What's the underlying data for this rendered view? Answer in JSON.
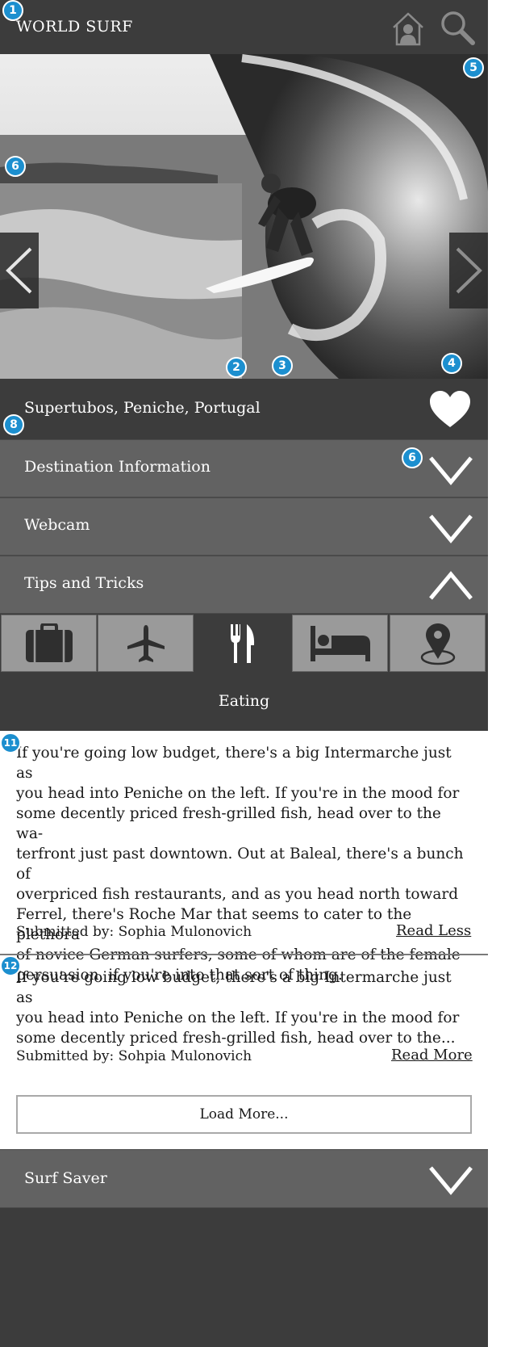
{
  "header": {
    "brand": "WORLD SURF",
    "home_icon": "home-person-icon",
    "search_icon": "search-icon"
  },
  "hero": {
    "image_desc_icon": "surfer-photo",
    "prev_icon": "chevron-left-icon",
    "next_icon": "chevron-right-icon"
  },
  "markers": [
    "1",
    "2",
    "3",
    "4",
    "5",
    "6",
    "6",
    "8",
    "11",
    "12"
  ],
  "location": {
    "title": "Supertubos, Peniche, Portugal",
    "favorite_icon": "heart-icon"
  },
  "accordion": [
    {
      "label": "Destination Information",
      "expanded": false
    },
    {
      "label": "Webcam",
      "expanded": false
    },
    {
      "label": "Tips and Tricks",
      "expanded": true
    },
    {
      "label": "Surf Saver",
      "expanded": false
    }
  ],
  "tabs": [
    {
      "icon": "suitcase-icon",
      "active": false
    },
    {
      "icon": "airplane-icon",
      "active": false
    },
    {
      "icon": "fork-knife-icon",
      "active": true
    },
    {
      "icon": "bed-icon",
      "active": false
    },
    {
      "icon": "location-pin-icon",
      "active": false
    }
  ],
  "active_tab_label": "Eating",
  "tips": [
    {
      "lines": [
        "If you're going low budget, there's a big Intermarche just as",
        "you head into Peniche on the left. If you're in the mood for",
        "some decently priced fresh-grilled fish, head over to the wa-",
        "terfront just past downtown. Out at Baleal, there's a bunch of",
        "overpriced fish restaurants, and as you head north toward",
        "Ferrel, there's Roche Mar that seems to cater to the plethora",
        "of novice German surfers, some of whom are of the female",
        "persuasion, if you're into that sort of thing."
      ],
      "submitted": "Submitted by:  Sophia Mulonovich",
      "toggle": "Read Less"
    },
    {
      "lines": [
        "If you're going low budget, there's a big Intermarche just as",
        "you head into Peniche on the left. If you're in the mood for",
        "some decently priced fresh-grilled fish, head over to the..."
      ],
      "submitted": "Submitted by:  Sohpia Mulonovich",
      "toggle": "Read More"
    }
  ],
  "load_more": "Load More...",
  "colors": {
    "dark": "#3c3c3c",
    "mid": "#626262",
    "tab_inactive": "#9a9a9a",
    "marker": "#1c8fcf"
  }
}
